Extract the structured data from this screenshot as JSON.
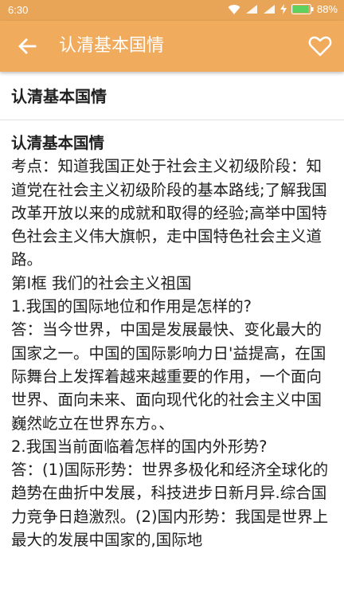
{
  "status_bar": {
    "time": "6:30",
    "battery": "88%",
    "icons": [
      "wifi-icon",
      "signal-icon",
      "signal-icon",
      "charging-icon",
      "battery-icon"
    ]
  },
  "app_bar": {
    "title": "认清基本国情",
    "back_icon": "arrow-left-icon",
    "favorite_icon": "heart-outline-icon",
    "color": "#f1ab5c"
  },
  "article": {
    "header_title": "认清基本国情",
    "body_heading": "认清基本国情",
    "paragraphs": [
      "考点：知道我国正处于社会主义初级阶段：知道党在社会主义初级阶段的基本路线;了解我国改革开放以来的成就和取得的经验;高举中国特色社会主义伟大旗帜，走中国特色社会主义道路。",
      "第Ⅰ框 我们的社会主义祖国",
      "1.我国的国际地位和作用是怎样的?",
      "答：当今世界，中国是发展最快、变化最大的国家之一。中国的国际影响力日'益提高，在国际舞台上发挥着越来越重要的作用，一个面向世界、面向未来、面向现代化的社会主义中国巍然屹立在世界东方。、",
      "2.我国当前面临着怎样的国内外形势?",
      "答：(1)国际形势：世界多极化和经济全球化的趋势在曲折中发展，科技进步日新月异.综合国力竞争日趋激烈。(2)国内形势：我国是世界上最大的发展中国家的,国际地"
    ]
  }
}
